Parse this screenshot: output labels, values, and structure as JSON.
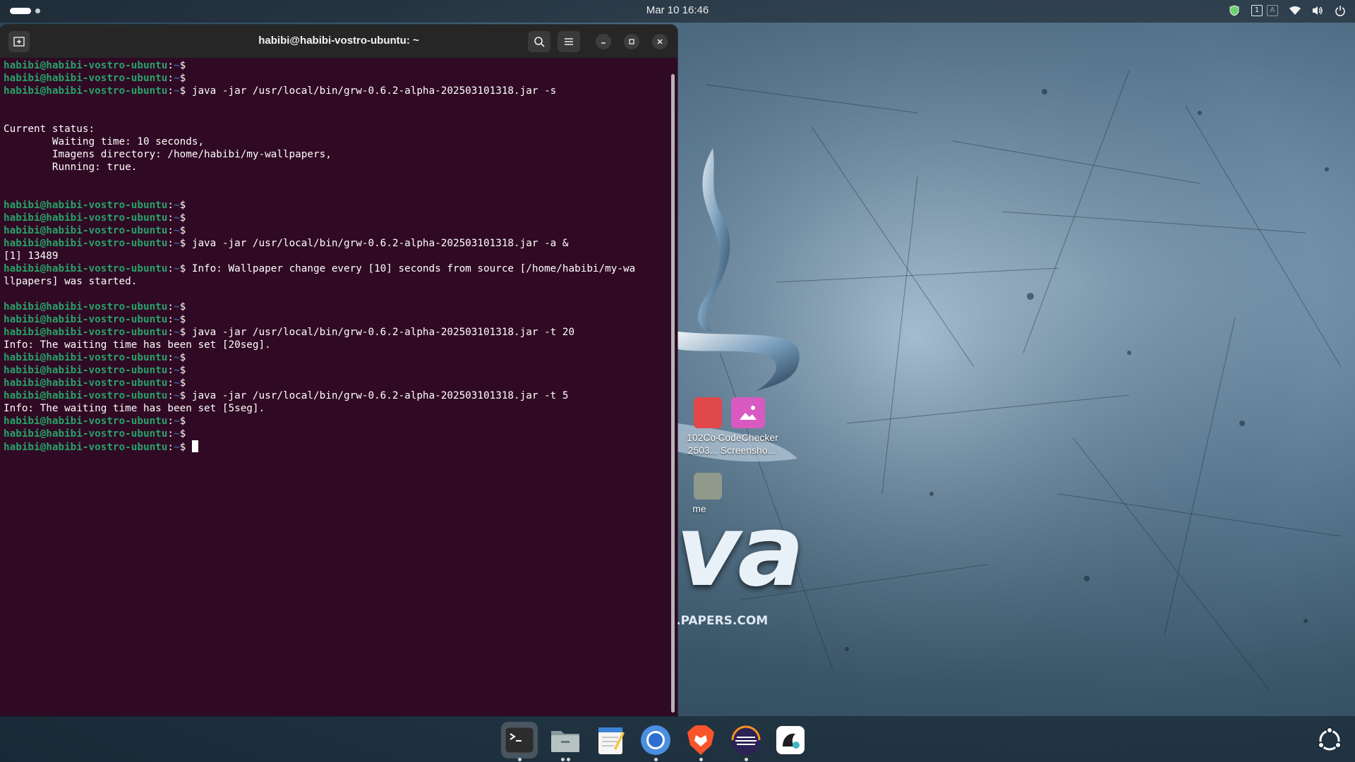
{
  "topbar": {
    "clock": "Mar 10  16:46",
    "keyboard_indicator_1": "1",
    "keyboard_indicator_2": "A"
  },
  "terminal": {
    "title": "habibi@habibi-vostro-ubuntu: ~",
    "prompt_user": "habibi@habibi-vostro-ubuntu",
    "prompt_path": "~",
    "lines": [
      {
        "type": "prompt",
        "cmd": ""
      },
      {
        "type": "prompt",
        "cmd": ""
      },
      {
        "type": "prompt",
        "cmd": "java -jar /usr/local/bin/grw-0.6.2-alpha-202503101318.jar -s"
      },
      {
        "type": "text",
        "text": ""
      },
      {
        "type": "text",
        "text": ""
      },
      {
        "type": "text",
        "text": "Current status:"
      },
      {
        "type": "text",
        "text": "        Waiting time: 10 seconds,"
      },
      {
        "type": "text",
        "text": "        Imagens directory: /home/habibi/my-wallpapers,"
      },
      {
        "type": "text",
        "text": "        Running: true."
      },
      {
        "type": "text",
        "text": ""
      },
      {
        "type": "text",
        "text": ""
      },
      {
        "type": "prompt",
        "cmd": ""
      },
      {
        "type": "prompt",
        "cmd": ""
      },
      {
        "type": "prompt",
        "cmd": ""
      },
      {
        "type": "prompt",
        "cmd": "java -jar /usr/local/bin/grw-0.6.2-alpha-202503101318.jar -a &"
      },
      {
        "type": "text",
        "text": "[1] 13489"
      },
      {
        "type": "prompt",
        "cmd": "Info: Wallpaper change every [10] seconds from source [/home/habibi/my-wa"
      },
      {
        "type": "text",
        "text": "llpapers] was started."
      },
      {
        "type": "text",
        "text": ""
      },
      {
        "type": "prompt",
        "cmd": ""
      },
      {
        "type": "prompt",
        "cmd": ""
      },
      {
        "type": "prompt",
        "cmd": "java -jar /usr/local/bin/grw-0.6.2-alpha-202503101318.jar -t 20"
      },
      {
        "type": "text",
        "text": "Info: The waiting time has been set [20seg]."
      },
      {
        "type": "prompt",
        "cmd": ""
      },
      {
        "type": "prompt",
        "cmd": ""
      },
      {
        "type": "prompt",
        "cmd": ""
      },
      {
        "type": "prompt",
        "cmd": "java -jar /usr/local/bin/grw-0.6.2-alpha-202503101318.jar -t 5"
      },
      {
        "type": "text",
        "text": "Info: The waiting time has been set [5seg]."
      },
      {
        "type": "prompt",
        "cmd": ""
      },
      {
        "type": "prompt",
        "cmd": ""
      },
      {
        "type": "cursor",
        "cmd": ""
      }
    ]
  },
  "desktop": {
    "icons": [
      {
        "line1": "102Co-",
        "line2": "2503..."
      },
      {
        "line1": "CodeChecker",
        "line2": "Screensho..."
      },
      {
        "line1": "me",
        "line2": ""
      }
    ],
    "wallpaper_text_big": "va",
    "wallpaper_text_small": ".PAPERS.COM"
  },
  "dock": {
    "items": [
      "terminal-icon",
      "files-icon",
      "text-editor-icon",
      "chromium-icon",
      "brave-icon",
      "eclipse-icon",
      "app-icon",
      "show-apps-icon"
    ]
  },
  "colors": {
    "terminal_bg": "#300a24",
    "prompt_green": "#26a269",
    "path_blue": "#3465a4",
    "titlebar": "#262626"
  }
}
